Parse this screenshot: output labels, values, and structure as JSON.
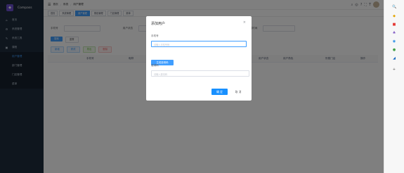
{
  "app": {
    "name": "Compass"
  },
  "sidebar": {
    "items": [
      {
        "label": "首页",
        "icon": "home-icon",
        "glyph": "⌂"
      },
      {
        "label": "系统管理",
        "icon": "gear-icon",
        "glyph": "⚙"
      },
      {
        "label": "系统工具",
        "icon": "tools-icon",
        "glyph": "✎"
      },
      {
        "label": "课程",
        "icon": "book-icon",
        "glyph": "▣"
      }
    ],
    "submenu": [
      "用户管理",
      "部门管理",
      "门店管理",
      "菜单"
    ]
  },
  "navbar": {
    "breadcrumb": [
      "首页",
      "系统",
      "用户管理"
    ],
    "separator": "/"
  },
  "tags": [
    "首页",
    "系统管理",
    "用户管理",
    "角色管理",
    "门店管理",
    "菜单"
  ],
  "filters": {
    "label1": "手机号",
    "label2": "用户状态",
    "label3": "创建时间",
    "sep": "-"
  },
  "buttons": {
    "search": "搜索",
    "reset": "重置",
    "add": "新增",
    "edit": "修改",
    "delete": "删除",
    "export": "导出"
  },
  "table": {
    "headers": [
      "手机号",
      "昵称",
      "用户状态",
      "用户角色",
      "所属门店",
      "操作"
    ]
  },
  "dialog": {
    "title": "添加用户",
    "close": "×",
    "phone_label": "手机号",
    "phone_placeholder": "请输入手机号码",
    "generate_button": "生成邀请码",
    "code_label": "邀请码",
    "code_placeholder": "请输入邀请码",
    "ok": "确 定",
    "cancel": "取 消"
  },
  "rightbar": [
    "🔍",
    "◆",
    "■",
    "♣",
    "◉",
    "●",
    "◢",
    "+"
  ],
  "colors": {
    "primary": "#409eff",
    "sidebar": "#1f2d3d",
    "overlay": "rgba(0,0,0,0.5)"
  }
}
